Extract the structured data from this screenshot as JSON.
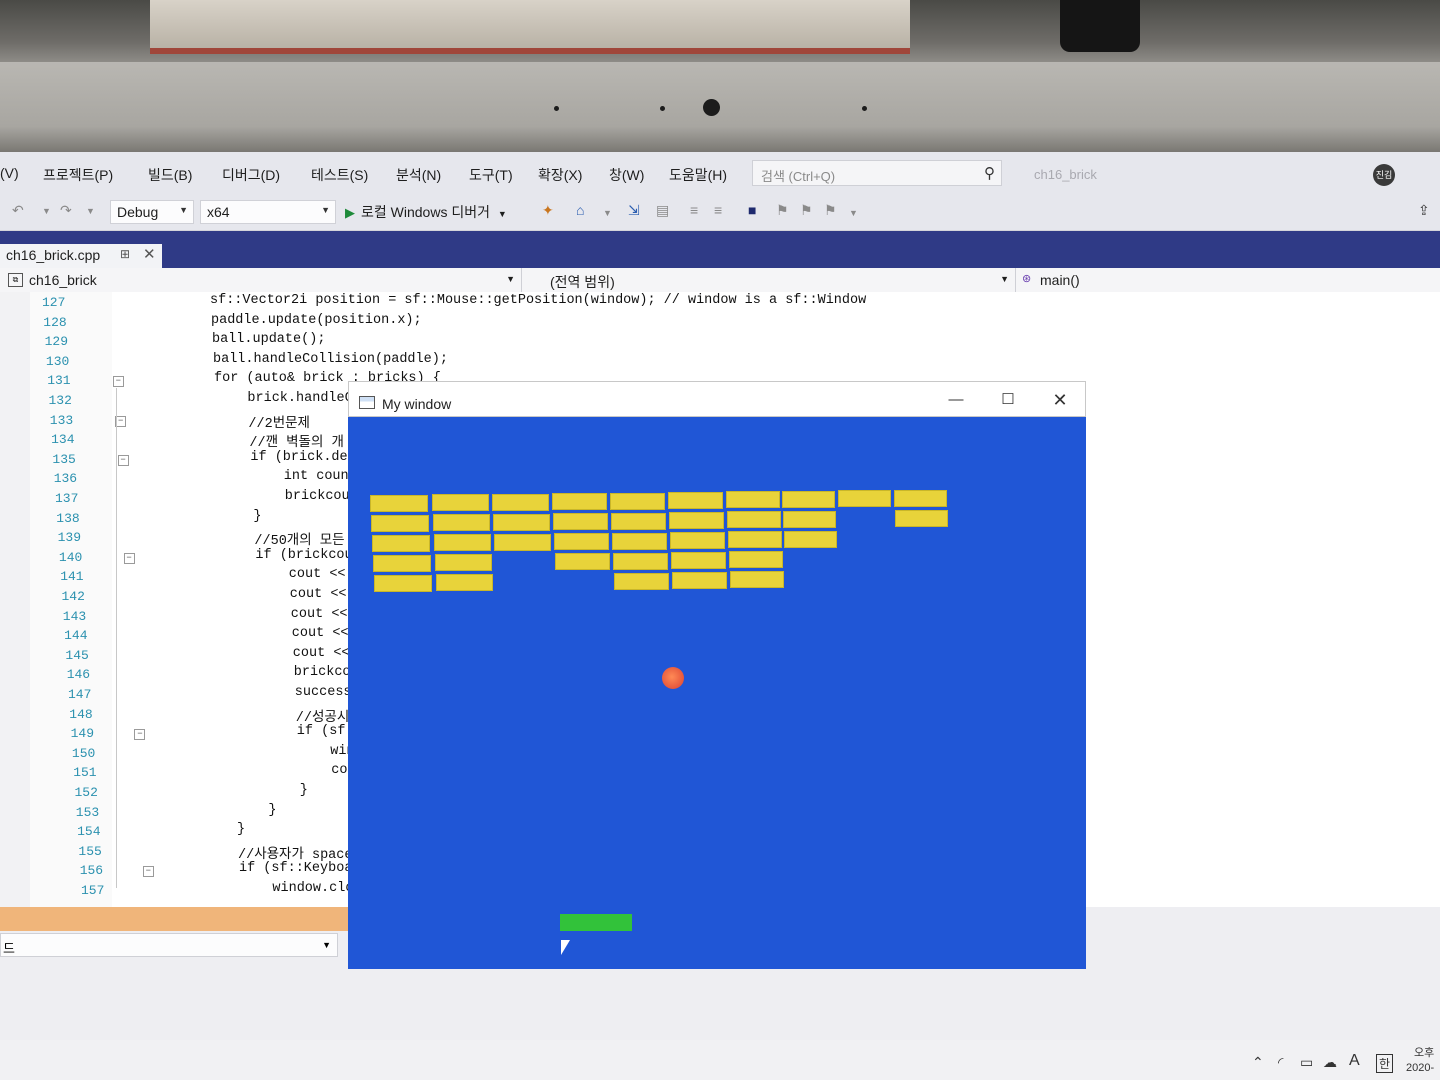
{
  "menu": [
    "(V)",
    "프로젝트(P)",
    "빌드(B)",
    "디버그(D)",
    "테스트(S)",
    "분석(N)",
    "도구(T)",
    "확장(X)",
    "창(W)",
    "도움말(H)"
  ],
  "search": {
    "placeholder": "검색 (Ctrl+Q)",
    "icon": "search-icon"
  },
  "project_title": "ch16_brick",
  "avatar_text": "진김",
  "toolbar": {
    "config": "Debug",
    "platform": "x64",
    "run_label": "로컬 Windows 디버거"
  },
  "tab": {
    "filename": "ch16_brick.cpp"
  },
  "nav": {
    "project": "ch16_brick",
    "scope": "(전역 범위)",
    "member": "main()"
  },
  "editor": {
    "line_numbers": [
      "127",
      "128",
      "129",
      "130",
      "131",
      "132",
      "133",
      "134",
      "135",
      "136",
      "137",
      "138",
      "139",
      "140",
      "141",
      "142",
      "143",
      "144",
      "145",
      "146",
      "147",
      "148",
      "149",
      "150",
      "151",
      "152",
      "153",
      "154",
      "155",
      "156",
      "157"
    ],
    "lines": [
      "sf::Vector2i position = sf::Mouse::getPosition(window); // window is a sf::Window",
      "paddle.update(position.x);",
      "ball.update();",
      "ball.handleCollision(paddle);",
      "for (auto& brick : bricks) {",
      "    brick.handleCo",
      "    //2번문제",
      "    //깬 벽돌의 개",
      "    if (brick.del",
      "        int count",
      "        brickcoun",
      "    }",
      "    //50개의 모든",
      "    if (brickcoun",
      "        cout << \"",
      "        cout << \"",
      "        cout << \"",
      "        cout << \"",
      "        cout << \"",
      "        brickcoun",
      "        success =",
      "        //성공시",
      "        if (sf::K",
      "            windo",
      "            cout",
      "        }",
      "    }",
      "}",
      "//사용자가 space바",
      "if (sf::Keyboard:",
      "    window.close("
    ]
  },
  "bottom_panel": {
    "label": "드"
  },
  "game_window": {
    "title": "My window",
    "background_color": "#2056d6",
    "brick_color": "#e8d33a",
    "ball_color": "#e6563c",
    "paddle_color": "#32c23a"
  },
  "taskbar": {
    "ampm": "오후",
    "date": "2020-",
    "ime": "한",
    "lang": "A"
  }
}
